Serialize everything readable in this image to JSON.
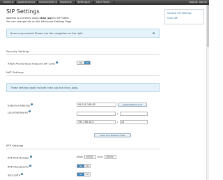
{
  "navbar": {
    "items": [
      {
        "label": "Admin"
      },
      {
        "label": "Applications"
      },
      {
        "label": "Connectivity"
      },
      {
        "label": "Reports"
      },
      {
        "label": "Settings"
      },
      {
        "label": "User Panel"
      }
    ],
    "logout_label": "Logout: admin"
  },
  "page": {
    "title": "SIP Settings",
    "intro_prefix": "Asterisk is currently using ",
    "intro_driver": "chan_sip",
    "intro_suffix": " for SIP Traffic.",
    "intro_line2": "You can change this on the Advanced Settings Page"
  },
  "side_panel": {
    "links": [
      "General SIP Settings",
      "Chan SIP"
    ]
  },
  "notice": {
    "text": "Items may moved! Please use the navigation on the right"
  },
  "security": {
    "heading": "Security Settings",
    "anon_label": "Allow Anonymous Inbound SIP Calls",
    "yes": "Yes",
    "no": "No",
    "selected": "No"
  },
  "nat": {
    "heading": "NAT Settings",
    "info": "These settings apply to both chan_sip and chan_pjsip.",
    "external_label": "External Address",
    "external_value": "99.100.246.65",
    "detect_button": "Detect External IP",
    "local_label": "Local Networks",
    "local_rows": [
      {
        "network": "",
        "mask": ""
      },
      {
        "network": "192.168.18.0",
        "mask": "24"
      }
    ],
    "add_button": "Add Local Network Field"
  },
  "rtp": {
    "heading": "RTP Settings",
    "port_label": "RTP Port Ranges",
    "start_label": "Start:",
    "start_value": "10000",
    "end_label": "End:",
    "end_value": "20000",
    "checksums_label": "RTP Checksums",
    "checksums_selected": "Yes",
    "strict_label": "Strict RTP",
    "strict_selected": "Yes",
    "yes": "Yes",
    "no": "No"
  },
  "colors": {
    "navbar": "#3f3f3f",
    "accent": "#3d83b8",
    "banner_bg": "#e6f2f9",
    "link": "#2b6f96"
  }
}
